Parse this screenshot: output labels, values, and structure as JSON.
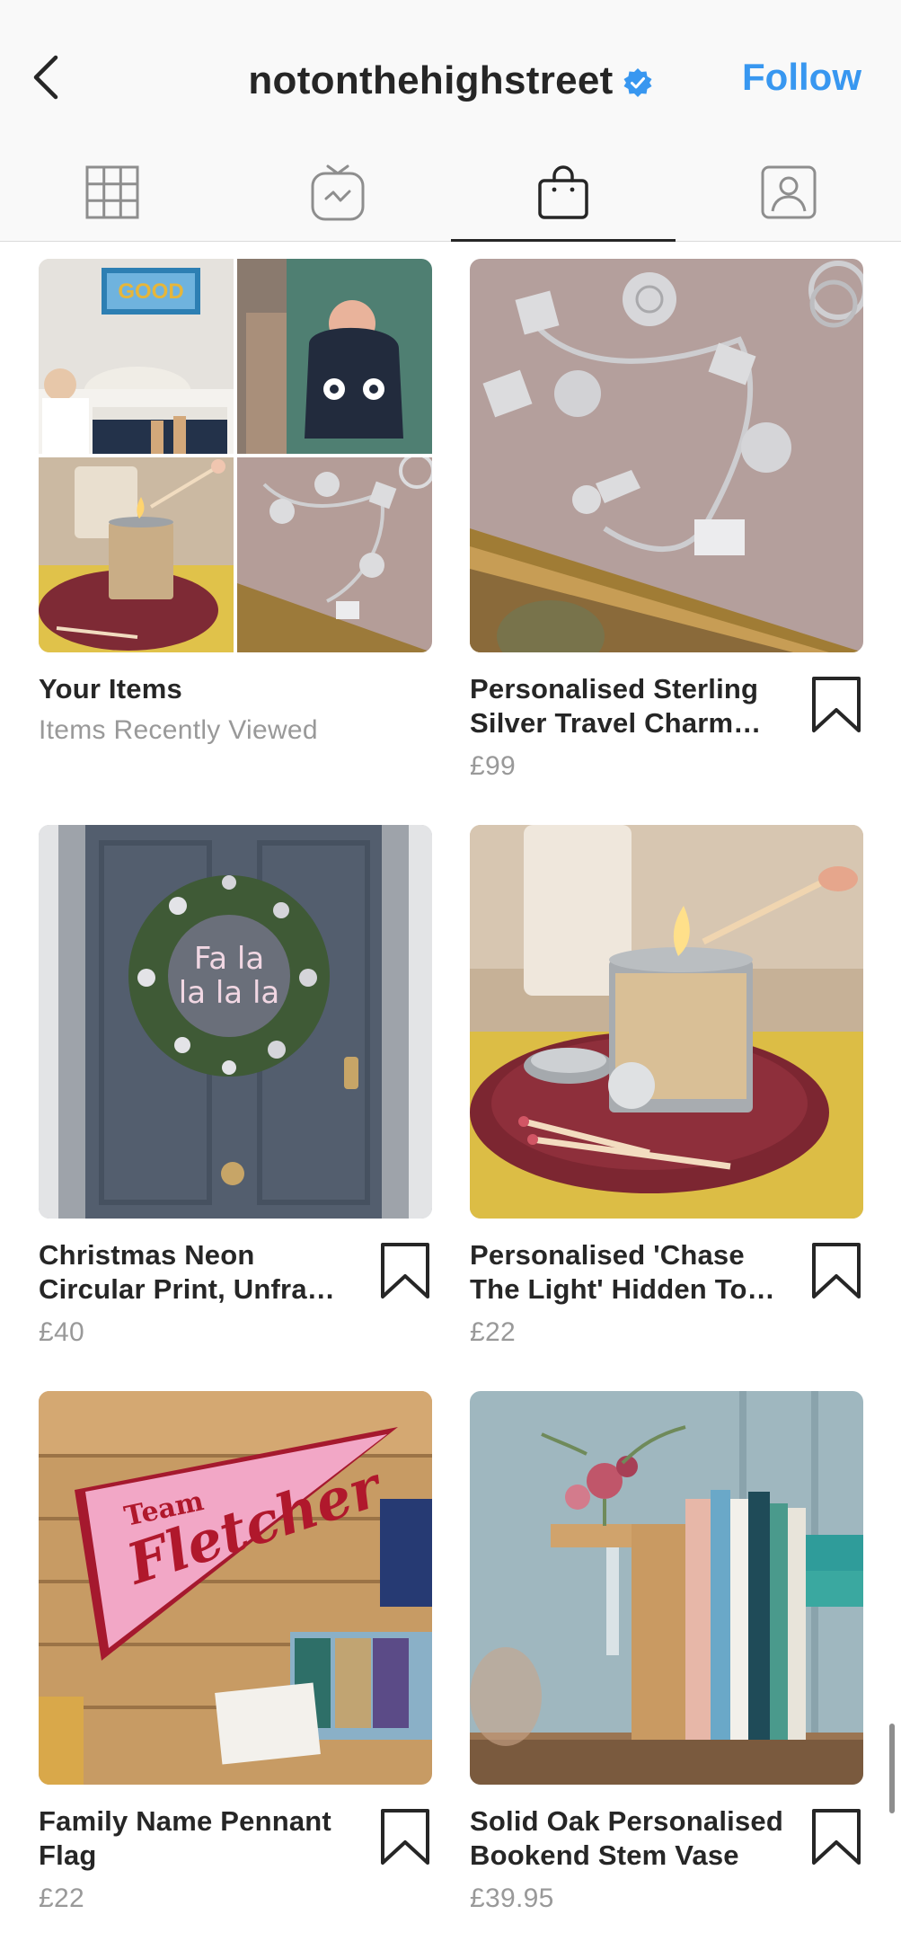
{
  "header": {
    "title": "notonthehighstreet",
    "follow_label": "Follow",
    "back_icon": "chevron-left-icon",
    "verified_icon": "verified-badge-icon",
    "accent_color": "#3897f0"
  },
  "tabs": [
    {
      "icon": "grid-icon",
      "active": false
    },
    {
      "icon": "igtv-icon",
      "active": false
    },
    {
      "icon": "shopping-bag-icon",
      "active": true
    },
    {
      "icon": "tagged-person-icon",
      "active": false
    }
  ],
  "cards": [
    {
      "title": "Your Items",
      "subtitle": "Items Recently Viewed"
    },
    {
      "title": "Personalised Sterling Silver Travel Charm…",
      "price": "£99"
    },
    {
      "title": "Christmas Neon Circular Print, Unfra…",
      "price": "£40",
      "neon_text_1": "Fa la",
      "neon_text_2": "la la la"
    },
    {
      "title": "Personalised 'Chase The Light' Hidden To…",
      "price": "£22"
    },
    {
      "title": "Family Name Pennant Flag",
      "price": "£22",
      "pennant_text_1": "Team",
      "pennant_text_2": "Fletcher"
    },
    {
      "title": "Solid Oak Personalised Bookend Stem Vase",
      "price": "£39.95"
    }
  ],
  "collage_sign": "GOOD"
}
